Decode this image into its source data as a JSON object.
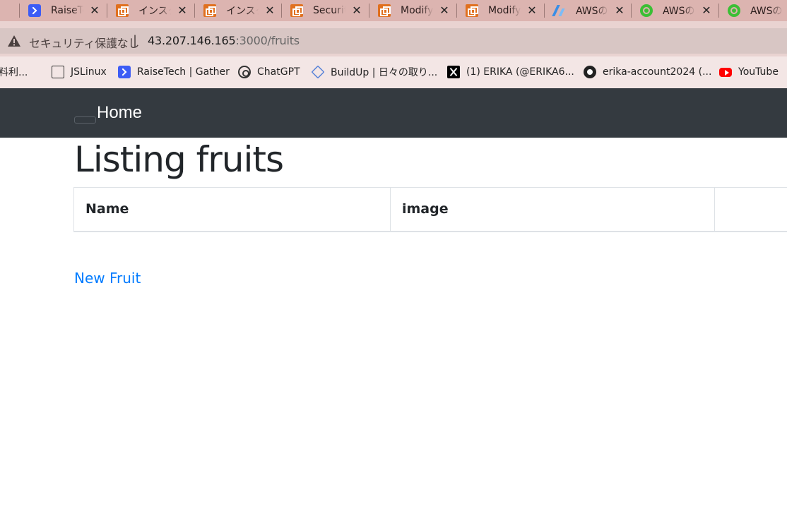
{
  "browser": {
    "tabs": [
      {
        "title": "RaiseTech",
        "favicon": "raisetech-icon"
      },
      {
        "title": "インスタンス",
        "favicon": "aws-console-icon"
      },
      {
        "title": "インスタンス",
        "favicon": "aws-console-icon"
      },
      {
        "title": "Security",
        "favicon": "aws-console-icon"
      },
      {
        "title": "Modify",
        "favicon": "aws-console-icon"
      },
      {
        "title": "Modify",
        "favicon": "aws-console-icon"
      },
      {
        "title": "AWSの",
        "favicon": "amplify-icon"
      },
      {
        "title": "AWSの",
        "favicon": "green-circle-icon"
      },
      {
        "title": "AWSの",
        "favicon": "green-circle-icon"
      }
    ],
    "close_glyph": "✕",
    "security_label": "セキュリティ保護なし",
    "divider": "|",
    "url_host": "43.207.146.165",
    "url_path": ":3000/fruits",
    "bookmarks": [
      {
        "label": "料利...",
        "icon": ""
      },
      {
        "label": "JSLinux",
        "icon": "document-icon"
      },
      {
        "label": "RaiseTech | Gather",
        "icon": "raisetech-icon"
      },
      {
        "label": "ChatGPT",
        "icon": "chatgpt-icon"
      },
      {
        "label": "BuildUp | 日々の取り...",
        "icon": "buildup-icon"
      },
      {
        "label": "(1) ERIKA (@ERIKA6...",
        "icon": "x-icon"
      },
      {
        "label": "erika-account2024 (...",
        "icon": "github-icon"
      },
      {
        "label": "YouTube",
        "icon": "youtube-icon"
      }
    ]
  },
  "navbar": {
    "brand": "Home"
  },
  "main": {
    "title": "Listing fruits",
    "table": {
      "columns": [
        "Name",
        "image",
        ""
      ]
    },
    "new_link": "New Fruit"
  },
  "colors": {
    "navbar_bg": "#343a40",
    "link": "#007bff",
    "tabstrip_bg": "#dcb4b0"
  }
}
